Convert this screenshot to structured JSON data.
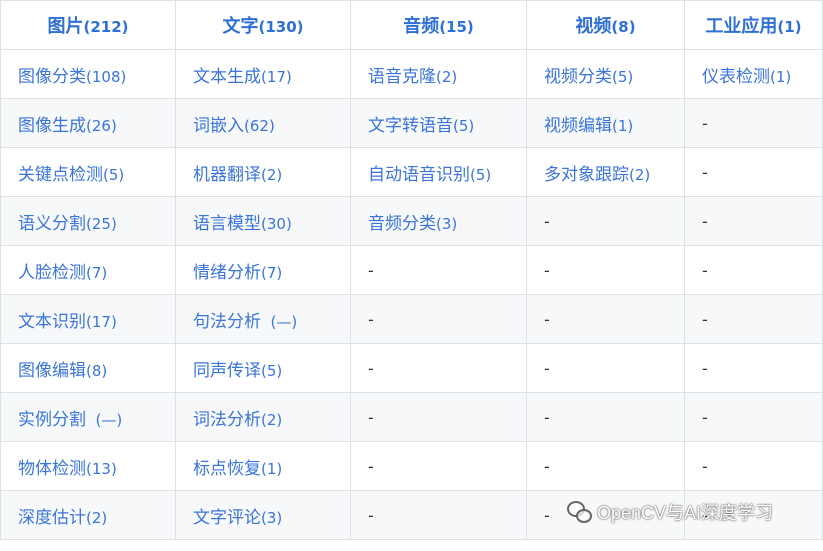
{
  "headers": [
    {
      "label": "图片",
      "count": "(212)"
    },
    {
      "label": "文字",
      "count": "(130)"
    },
    {
      "label": "音频",
      "count": "(15)"
    },
    {
      "label": "视频",
      "count": "(8)"
    },
    {
      "label": "工业应用",
      "count": "(1)"
    }
  ],
  "rows": [
    [
      {
        "label": "图像分类",
        "count": "(108)"
      },
      {
        "label": "文本生成",
        "count": "(17)"
      },
      {
        "label": "语音克隆",
        "count": "(2)"
      },
      {
        "label": "视频分类",
        "count": "(5)"
      },
      {
        "label": "仪表检测",
        "count": "(1)"
      }
    ],
    [
      {
        "label": "图像生成",
        "count": "(26)"
      },
      {
        "label": "词嵌入",
        "count": "(62)"
      },
      {
        "label": "文字转语音",
        "count": "(5)"
      },
      {
        "label": "视频编辑",
        "count": "(1)"
      },
      {
        "label": "-",
        "count": ""
      }
    ],
    [
      {
        "label": "关键点检测",
        "count": "(5)"
      },
      {
        "label": "机器翻译",
        "count": "(2)"
      },
      {
        "label": "自动语音识别",
        "count": "(5)"
      },
      {
        "label": "多对象跟踪",
        "count": "(2)"
      },
      {
        "label": "-",
        "count": ""
      }
    ],
    [
      {
        "label": "语义分割",
        "count": "(25)"
      },
      {
        "label": "语言模型",
        "count": "(30)"
      },
      {
        "label": "音频分类",
        "count": "(3)"
      },
      {
        "label": "-",
        "count": ""
      },
      {
        "label": "-",
        "count": ""
      }
    ],
    [
      {
        "label": "人脸检测",
        "count": "(7)"
      },
      {
        "label": "情绪分析",
        "count": "(7)"
      },
      {
        "label": "-",
        "count": ""
      },
      {
        "label": "-",
        "count": ""
      },
      {
        "label": "-",
        "count": ""
      }
    ],
    [
      {
        "label": "文本识别",
        "count": "(17)"
      },
      {
        "label": "句法分析",
        "count": "  (—)"
      },
      {
        "label": "-",
        "count": ""
      },
      {
        "label": "-",
        "count": ""
      },
      {
        "label": "-",
        "count": ""
      }
    ],
    [
      {
        "label": "图像编辑",
        "count": "(8)"
      },
      {
        "label": "同声传译",
        "count": "(5)"
      },
      {
        "label": "-",
        "count": ""
      },
      {
        "label": "-",
        "count": ""
      },
      {
        "label": "-",
        "count": ""
      }
    ],
    [
      {
        "label": "实例分割",
        "count": "  (—)"
      },
      {
        "label": "词法分析",
        "count": "(2)"
      },
      {
        "label": "-",
        "count": ""
      },
      {
        "label": "-",
        "count": ""
      },
      {
        "label": "-",
        "count": ""
      }
    ],
    [
      {
        "label": "物体检测",
        "count": "(13)"
      },
      {
        "label": "标点恢复",
        "count": "(1)"
      },
      {
        "label": "-",
        "count": ""
      },
      {
        "label": "-",
        "count": ""
      },
      {
        "label": "-",
        "count": ""
      }
    ],
    [
      {
        "label": "深度估计",
        "count": "(2)"
      },
      {
        "label": "文字评论",
        "count": "(3)"
      },
      {
        "label": "-",
        "count": ""
      },
      {
        "label": "-",
        "count": ""
      },
      {
        "label": "-",
        "count": ""
      }
    ]
  ],
  "watermark": {
    "text": "OpenCV与AI深度学习",
    "icon": "wechat-icon"
  }
}
